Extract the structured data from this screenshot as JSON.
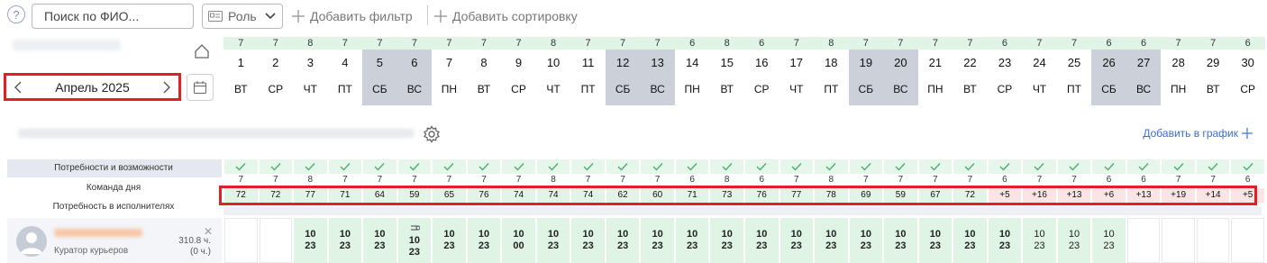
{
  "toolbar": {
    "help_icon": "question-circle-icon",
    "search_placeholder": "Поиск по ФИО...",
    "role_label": "Роль",
    "add_filter_label": "Добавить фильтр",
    "add_sort_label": "Добавить сортировку"
  },
  "calendar": {
    "month_label": "Апрель 2025",
    "days": [
      {
        "d": "1",
        "w": "ВТ",
        "c": "7"
      },
      {
        "d": "2",
        "w": "СР",
        "c": "7"
      },
      {
        "d": "3",
        "w": "ЧТ",
        "c": "8"
      },
      {
        "d": "4",
        "w": "ПТ",
        "c": "7"
      },
      {
        "d": "5",
        "w": "СБ",
        "c": "7",
        "weekend": true
      },
      {
        "d": "6",
        "w": "ВС",
        "c": "7",
        "weekend": true
      },
      {
        "d": "7",
        "w": "ПН",
        "c": "7"
      },
      {
        "d": "8",
        "w": "ВТ",
        "c": "7"
      },
      {
        "d": "9",
        "w": "СР",
        "c": "7"
      },
      {
        "d": "10",
        "w": "ЧТ",
        "c": "8"
      },
      {
        "d": "11",
        "w": "ПТ",
        "c": "7"
      },
      {
        "d": "12",
        "w": "СБ",
        "c": "7",
        "weekend": true
      },
      {
        "d": "13",
        "w": "ВС",
        "c": "7",
        "weekend": true
      },
      {
        "d": "14",
        "w": "ПН",
        "c": "6"
      },
      {
        "d": "15",
        "w": "ВТ",
        "c": "8"
      },
      {
        "d": "16",
        "w": "СР",
        "c": "6"
      },
      {
        "d": "17",
        "w": "ЧТ",
        "c": "7"
      },
      {
        "d": "18",
        "w": "ПТ",
        "c": "8"
      },
      {
        "d": "19",
        "w": "СБ",
        "c": "7",
        "weekend": true
      },
      {
        "d": "20",
        "w": "ВС",
        "c": "7",
        "weekend": true
      },
      {
        "d": "21",
        "w": "ПН",
        "c": "7"
      },
      {
        "d": "22",
        "w": "ВТ",
        "c": "7"
      },
      {
        "d": "23",
        "w": "СР",
        "c": "6"
      },
      {
        "d": "24",
        "w": "ЧТ",
        "c": "7"
      },
      {
        "d": "25",
        "w": "ПТ",
        "c": "7"
      },
      {
        "d": "26",
        "w": "СБ",
        "c": "6",
        "weekend": true
      },
      {
        "d": "27",
        "w": "ВС",
        "c": "6",
        "weekend": true
      },
      {
        "d": "28",
        "w": "ПН",
        "c": "7"
      },
      {
        "d": "29",
        "w": "ВТ",
        "c": "7"
      },
      {
        "d": "30",
        "w": "СР",
        "c": "6"
      }
    ]
  },
  "section": {
    "add_to_schedule_label": "Добавить в график"
  },
  "metrics": {
    "needs_label": "Потребности и возможности",
    "team_label": "Команда дня",
    "demand_label": "Потребность в исполнителях",
    "team_counts": [
      "7",
      "7",
      "8",
      "7",
      "7",
      "7",
      "7",
      "7",
      "7",
      "8",
      "7",
      "7",
      "7",
      "6",
      "8",
      "6",
      "7",
      "8",
      "7",
      "7",
      "7",
      "7",
      "6",
      "7",
      "7",
      "6",
      "6",
      "7",
      "7",
      "6"
    ],
    "demand": [
      {
        "v": "72"
      },
      {
        "v": "72"
      },
      {
        "v": "77"
      },
      {
        "v": "71"
      },
      {
        "v": "64"
      },
      {
        "v": "59"
      },
      {
        "v": "65"
      },
      {
        "v": "76"
      },
      {
        "v": "74"
      },
      {
        "v": "74"
      },
      {
        "v": "74"
      },
      {
        "v": "62"
      },
      {
        "v": "60"
      },
      {
        "v": "71"
      },
      {
        "v": "73"
      },
      {
        "v": "76"
      },
      {
        "v": "77"
      },
      {
        "v": "78"
      },
      {
        "v": "69"
      },
      {
        "v": "59"
      },
      {
        "v": "67"
      },
      {
        "v": "72"
      },
      {
        "v": "+5",
        "over": true
      },
      {
        "v": "+16",
        "over": true
      },
      {
        "v": "+13",
        "over": true
      },
      {
        "v": "+6",
        "over": true
      },
      {
        "v": "+13",
        "over": true
      },
      {
        "v": "+19",
        "over": true
      },
      {
        "v": "+14",
        "over": true
      },
      {
        "v": "+5",
        "over": true
      }
    ]
  },
  "person": {
    "role": "Куратор курьеров",
    "hours": "310.8 ч.",
    "hours_sub": "(0 ч.)",
    "close_icon": "close-icon",
    "shifts": [
      {
        "a": "",
        "b": "",
        "on": false
      },
      {
        "a": "",
        "b": "",
        "on": false
      },
      {
        "a": "10",
        "b": "23",
        "on": true
      },
      {
        "a": "10",
        "b": "23",
        "on": true
      },
      {
        "a": "10",
        "b": "23",
        "on": true
      },
      {
        "a": "10",
        "b": "23",
        "on": true,
        "icon": true
      },
      {
        "a": "10",
        "b": "23",
        "on": true
      },
      {
        "a": "10",
        "b": "23",
        "on": true
      },
      {
        "a": "10",
        "b": "00",
        "on": true
      },
      {
        "a": "10",
        "b": "23",
        "on": true
      },
      {
        "a": "10",
        "b": "23",
        "on": true
      },
      {
        "a": "10",
        "b": "23",
        "on": true
      },
      {
        "a": "10",
        "b": "23",
        "on": true
      },
      {
        "a": "10",
        "b": "23",
        "on": true
      },
      {
        "a": "10",
        "b": "23",
        "on": true
      },
      {
        "a": "10",
        "b": "23",
        "on": true
      },
      {
        "a": "10",
        "b": "23",
        "on": true
      },
      {
        "a": "10",
        "b": "23",
        "on": true
      },
      {
        "a": "10",
        "b": "23",
        "on": true
      },
      {
        "a": "10",
        "b": "23",
        "on": true
      },
      {
        "a": "10",
        "b": "23",
        "on": true
      },
      {
        "a": "10",
        "b": "23",
        "on": true
      },
      {
        "a": "10",
        "b": "23",
        "on": true
      },
      {
        "a": "10",
        "b": "23",
        "on": true,
        "light": true
      },
      {
        "a": "10",
        "b": "23",
        "on": true,
        "light": true
      },
      {
        "a": "10",
        "b": "23",
        "on": true,
        "light": true
      },
      {
        "a": "",
        "b": "",
        "on": false
      },
      {
        "a": "",
        "b": "",
        "on": false
      },
      {
        "a": "",
        "b": "",
        "on": false
      },
      {
        "a": "",
        "b": "",
        "on": false
      }
    ]
  }
}
